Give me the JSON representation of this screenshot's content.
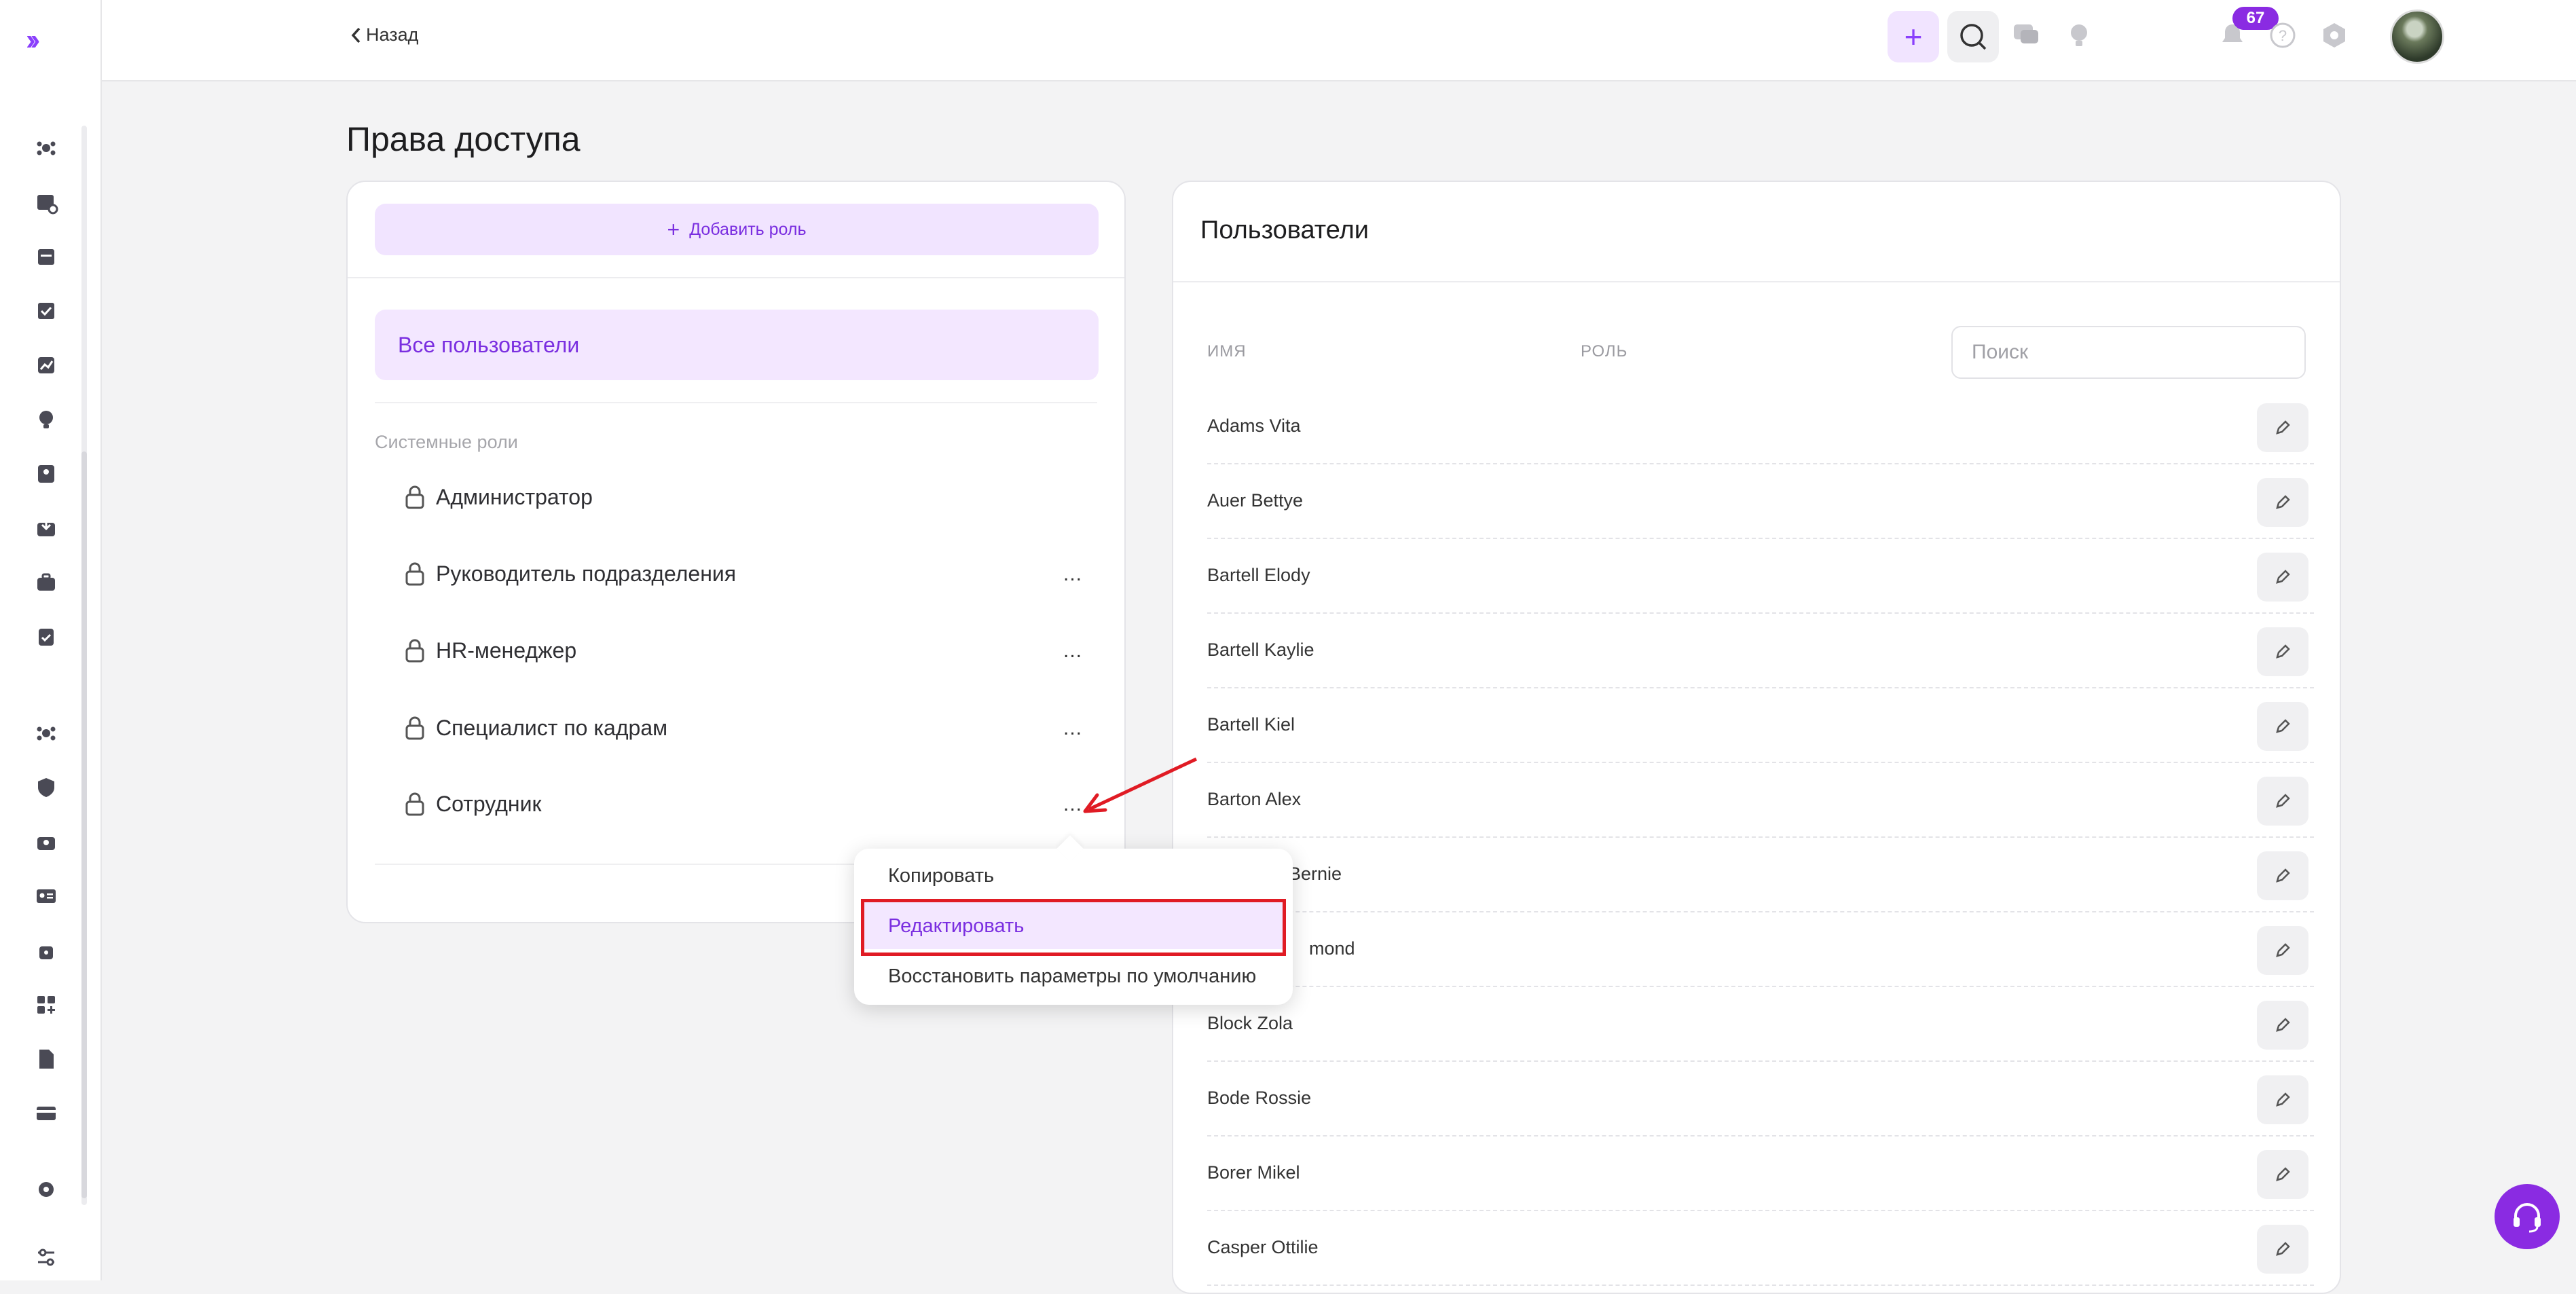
{
  "header": {
    "back_label": "Назад",
    "notifications_count": "67"
  },
  "page": {
    "title": "Права доступа"
  },
  "roles_panel": {
    "add_role_label": "Добавить роль",
    "all_users_label": "Все пользователи",
    "system_roles_label": "Системные роли",
    "roles": [
      {
        "name": "Администратор"
      },
      {
        "name": "Руководитель подразделения"
      },
      {
        "name": "HR-менеджер"
      },
      {
        "name": "Специалист по кадрам"
      },
      {
        "name": "Сотрудник"
      }
    ],
    "more_label": "..."
  },
  "users_panel": {
    "title": "Пользователи",
    "col_name": "ИМЯ",
    "col_role": "РОЛЬ",
    "search_placeholder": "Поиск",
    "users": [
      "Adams Vita",
      "Auer Bettye",
      "Bartell Elody",
      "Bartell Kaylie",
      "Bartell Kiel",
      "Barton Alex",
      "Bernie",
      "mond",
      "Block Zola",
      "Bode Rossie",
      "Borer Mikel",
      "Casper Ottilie"
    ]
  },
  "context_menu": {
    "items": [
      "Копировать",
      "Редактировать",
      "Восстановить параметры по умолчанию"
    ],
    "selected": "Редактировать"
  },
  "colors": {
    "accent": "#8a2be2",
    "accent_light": "#f1e4ff",
    "highlight": "#e01b24"
  }
}
